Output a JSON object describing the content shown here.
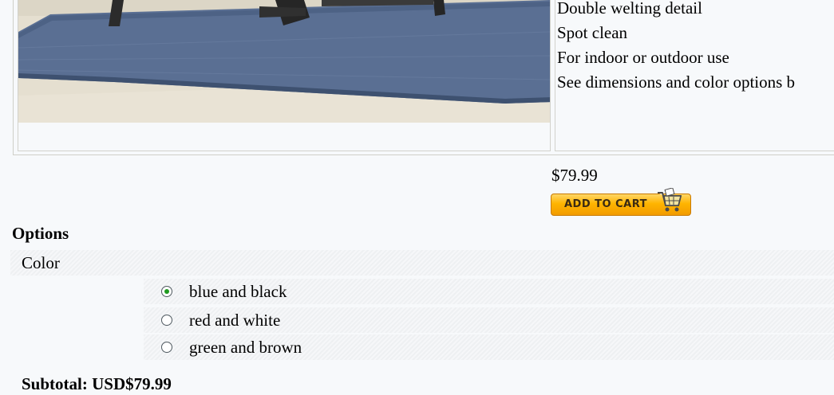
{
  "product": {
    "features": [
      "Double welting detail",
      "Spot clean",
      "For indoor or outdoor use",
      "See dimensions and color options b"
    ],
    "price": "$79.99",
    "add_to_cart_label": "ADD TO CART",
    "cart_icon": "shopping-cart-icon"
  },
  "options": {
    "heading": "Options",
    "color_label": "Color",
    "choices": [
      {
        "label": "blue and black",
        "selected": true
      },
      {
        "label": "red and white",
        "selected": false
      },
      {
        "label": "green and brown",
        "selected": false
      }
    ]
  },
  "subtotal": "Subtotal: USD$79.99",
  "colors": {
    "rug": "#5a6f93",
    "floor": "#e6e0d2",
    "button": "#ffb400",
    "radio_selected": "#1f9a1f"
  }
}
